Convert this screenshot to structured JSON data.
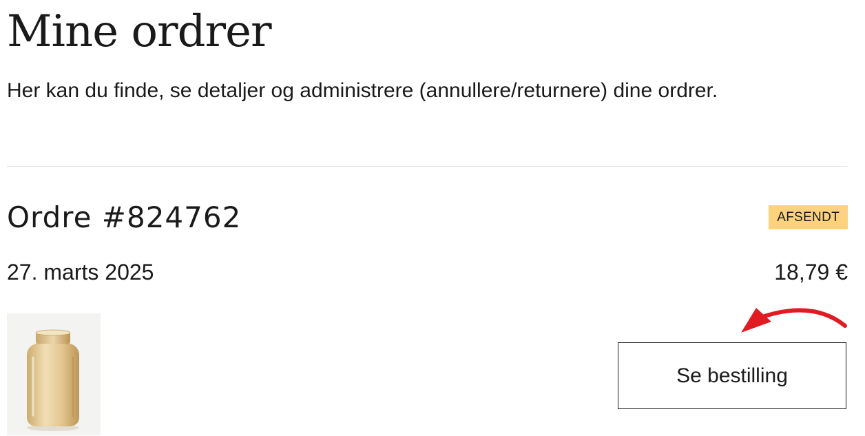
{
  "page": {
    "title": "Mine ordrer",
    "subtitle": "Her kan du finde, se detaljer og administrere (annullere/returnere) dine ordrer."
  },
  "order": {
    "number_label": "Ordre #824762",
    "status": "AFSENDT",
    "date": "27. marts 2025",
    "total": "18,79 €",
    "product_image": "amber-glass-vase",
    "view_button_label": "Se bestilling"
  },
  "colors": {
    "status_badge": "#fcd37c",
    "annotation_arrow": "#e01b22"
  }
}
